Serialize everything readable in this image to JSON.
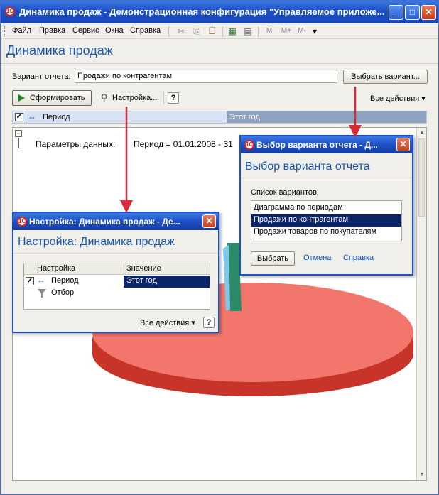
{
  "window": {
    "title": "Динамика продаж - Демонстрационная конфигурация \"Управляемое приложе...",
    "minimize_symbol": "_",
    "maximize_symbol": "□",
    "close_symbol": "✕"
  },
  "menu": [
    "Файл",
    "Правка",
    "Сервис",
    "Окна",
    "Справка"
  ],
  "toolbar_icons": {
    "cut": "✂",
    "copy": "⎘",
    "paste": "📋",
    "calc": "▦",
    "calendar": "▤",
    "m": "M",
    "mplus": "M+",
    "mminus": "M-",
    "more": "▾"
  },
  "form": {
    "title": "Динамика продаж",
    "variant_label": "Вариант отчета:",
    "variant_value": "Продажи по контрагентам",
    "choose_variant_button": "Выбрать вариант...",
    "generate_button": "Сформировать",
    "settings_button": "Настройка...",
    "help_label": "?",
    "all_actions": "Все действия ▾",
    "period_header": "Период",
    "period_value": "Этот год",
    "data_params": "Параметры данных:",
    "period_text": "Период = 01.01.2008 - 31"
  },
  "dialog_variant": {
    "title": "Выбор варианта отчета - Д...",
    "heading": "Выбор варианта отчета",
    "list_label": "Список вариантов:",
    "items": [
      "Диаграмма по периодам",
      "Продажи по контрагентам",
      "Продажи товаров по покупателям"
    ],
    "selected_index": 1,
    "choose_button": "Выбрать",
    "cancel_link": "Отмена",
    "help_link": "Справка"
  },
  "dialog_settings": {
    "title": "Настройка: Динамика продаж - Де...",
    "heading": "Настройка: Динамика продаж",
    "col_setting": "Настройка",
    "col_value": "Значение",
    "rows": [
      {
        "name": "Период",
        "value": "Этот год",
        "checked": true
      },
      {
        "name": "Отбор",
        "value": "",
        "checked": false
      }
    ],
    "all_actions": "Все действия ▾",
    "help_label": "?"
  },
  "colors": {
    "accent": "#1b56b0",
    "pie_top": "#f2766b",
    "pie_side": "#c8332a",
    "selection": "#0a246a",
    "arrow": "#d8293a"
  }
}
